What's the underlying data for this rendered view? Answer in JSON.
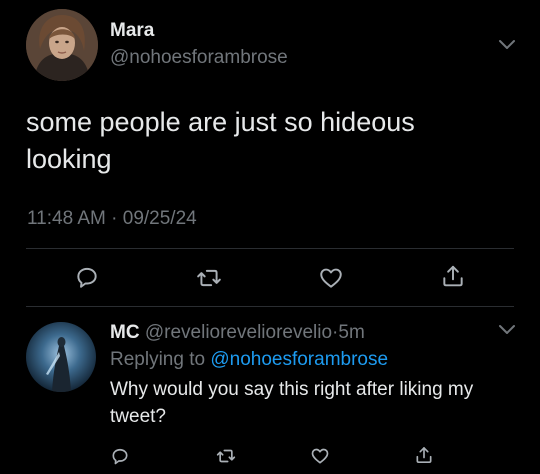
{
  "main_tweet": {
    "author_name": "Mara",
    "author_handle": "@nohoesforambrose",
    "text": "some people are just so hideous looking",
    "time": "11:48 AM",
    "separator": "·",
    "date": "09/25/24",
    "actions": [
      "reply-icon",
      "retweet-icon",
      "like-icon",
      "share-icon"
    ]
  },
  "reply_tweet": {
    "author_name": "MC",
    "author_handle": "@revelioreveliorevelio",
    "separator": "·",
    "relative_time": "5m",
    "replying_prefix": "Replying to",
    "replying_to": "@nohoesforambrose",
    "text": "Why would you say this right after liking my tweet?",
    "actions": [
      "reply-icon",
      "retweet-icon",
      "like-icon",
      "share-icon"
    ]
  },
  "colors": {
    "background": "#000000",
    "primary_text": "#e7e9ea",
    "secondary_text": "#71767b",
    "link": "#1d9bf0",
    "divider": "#2a2d31"
  }
}
